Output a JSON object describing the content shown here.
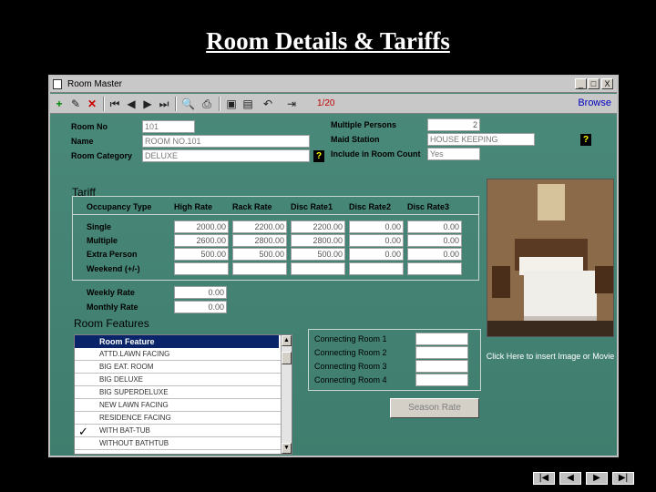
{
  "slide_title": "Room Details & Tariffs",
  "window": {
    "title": "Room Master",
    "min": "_",
    "max": "□",
    "close": "X"
  },
  "toolbar": {
    "record": "1/20",
    "browse": "Browse"
  },
  "room": {
    "room_no_label": "Room No",
    "room_no": "101",
    "name_label": "Name",
    "name": "ROOM NO.101",
    "category_label": "Room Category",
    "category": "DELUXE",
    "multiple_persons_label": "Multiple Persons",
    "multiple_persons": "2",
    "maid_station_label": "Maid Station",
    "maid_station": "HOUSE KEEPING",
    "include_label": "Include in Room Count",
    "include": "Yes",
    "help": "?"
  },
  "tariff": {
    "title": "Tariff",
    "headers": [
      "Occupancy Type",
      "High Rate",
      "Rack Rate",
      "Disc Rate1",
      "Disc Rate2",
      "Disc Rate3"
    ],
    "rows": [
      {
        "label": "Single",
        "values": [
          "2000.00",
          "2200.00",
          "2200.00",
          "0.00",
          "0.00"
        ]
      },
      {
        "label": "Multiple",
        "values": [
          "2600.00",
          "2800.00",
          "2800.00",
          "0.00",
          "0.00"
        ]
      },
      {
        "label": "Extra Person",
        "values": [
          "500.00",
          "500.00",
          "500.00",
          "0.00",
          "0.00"
        ]
      },
      {
        "label": "Weekend (+/-)",
        "values": [
          "",
          "",
          "",
          "",
          ""
        ]
      }
    ],
    "weekly_label": "Weekly Rate",
    "weekly": "0.00",
    "monthly_label": "Monthly Rate",
    "monthly": "0.00"
  },
  "features": {
    "title": "Room Features",
    "header": "Room Feature",
    "items": [
      "ATTD.LAWN FACING",
      "BIG EAT. ROOM",
      "BIG DELUXE",
      "BIG SUPERDELUXE",
      "NEW LAWN FACING",
      "RESIDENCE FACING",
      "WITH BAT-TUB",
      "WITHOUT BATHTUB"
    ],
    "checked_index": 6,
    "check_mark": "✓"
  },
  "connecting": {
    "labels": [
      "Connecting Room 1",
      "Connecting Room 2",
      "Connecting Room 3",
      "Connecting Room 4"
    ]
  },
  "image_caption": "Click Here to insert Image or Movie",
  "season_rate": "Season Rate",
  "nav": [
    "|◀",
    "◀",
    "▶",
    "▶|"
  ]
}
